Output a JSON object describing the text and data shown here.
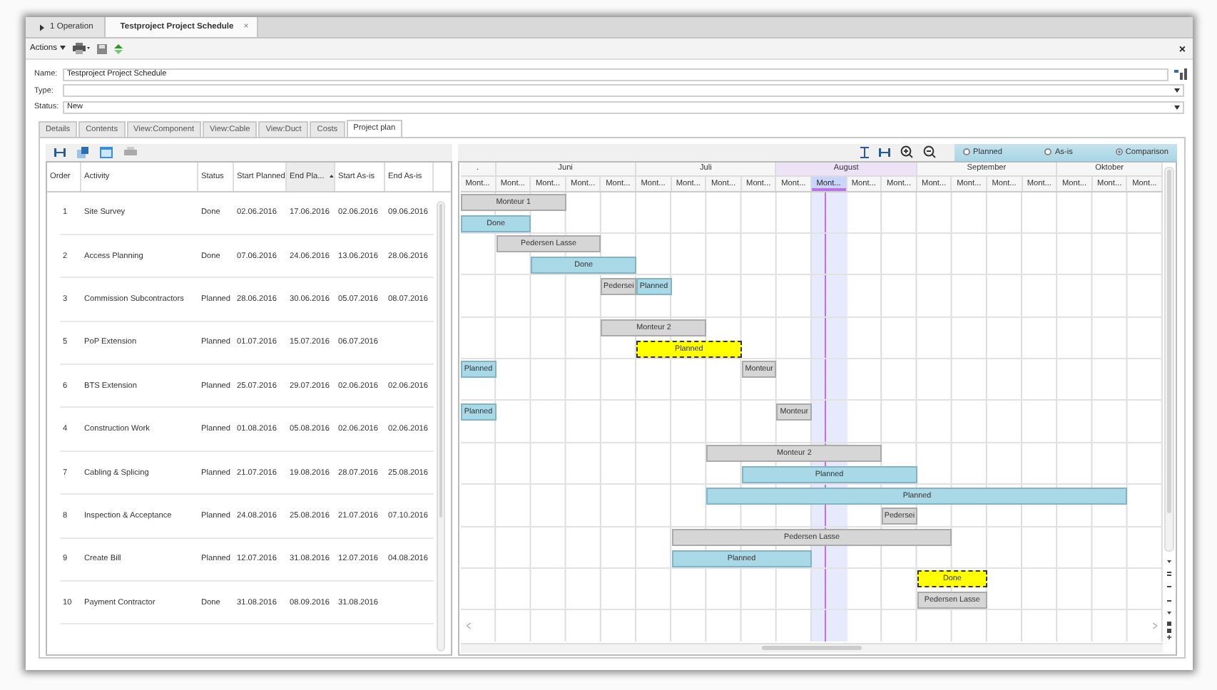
{
  "tabs": [
    {
      "label": "1 Operation",
      "selected": false,
      "kind": "group"
    },
    {
      "label": "Testproject Project Schedule",
      "selected": true,
      "kind": "document",
      "close": "×"
    }
  ],
  "toolbar": {
    "actions": "Actions",
    "close": "×"
  },
  "form": {
    "fields": [
      {
        "label": "Name:",
        "value": "Testproject Project Schedule",
        "kind": "text"
      },
      {
        "label": "Type:",
        "kind": "dropdown"
      },
      {
        "label": "Status:",
        "value": "New",
        "kind": "dropdown"
      }
    ]
  },
  "detail_tabs": [
    {
      "label": "Details",
      "selected": false
    },
    {
      "label": "Contents",
      "selected": false
    },
    {
      "label": "View:Component",
      "selected": false
    },
    {
      "label": "View:Cable",
      "selected": false
    },
    {
      "label": "View:Duct",
      "selected": false
    },
    {
      "label": "Costs",
      "selected": false
    },
    {
      "label": "Project plan",
      "selected": true
    }
  ],
  "table": {
    "columns": [
      {
        "label": "Order",
        "sorted": false
      },
      {
        "label": "Activity",
        "sorted": false
      },
      {
        "label": "Status",
        "sorted": false
      },
      {
        "label": "Start Planned",
        "sorted": false
      },
      {
        "label": "End Pla...",
        "sorted": true
      },
      {
        "label": "Start As-is",
        "sorted": false
      },
      {
        "label": "End As-is",
        "sorted": false
      }
    ],
    "rows": [
      [
        "1",
        "Site Survey",
        "Done",
        "02.06.2016",
        "17.06.2016",
        "02.06.2016",
        "09.06.2016"
      ],
      [
        "2",
        "Access Planning",
        "Done",
        "07.06.2016",
        "24.06.2016",
        "13.06.2016",
        "28.06.2016"
      ],
      [
        "3",
        "Commission Subcontractors",
        "Planned",
        "28.06.2016",
        "30.06.2016",
        "05.07.2016",
        "08.07.2016"
      ],
      [
        "5",
        "PoP Extension",
        "Planned",
        "01.07.2016",
        "15.07.2016",
        "06.07.2016",
        null
      ],
      [
        "6",
        "BTS Extension",
        "Planned",
        "25.07.2016",
        "29.07.2016",
        "02.06.2016",
        "02.06.2016"
      ],
      [
        "4",
        "Construction Work",
        "Planned",
        "01.08.2016",
        "05.08.2016",
        "02.06.2016",
        "02.06.2016"
      ],
      [
        "7",
        "Cabling & Splicing",
        "Planned",
        "21.07.2016",
        "19.08.2016",
        "28.07.2016",
        "25.08.2016"
      ],
      [
        "8",
        "Inspection & Acceptance",
        "Planned",
        "24.08.2016",
        "25.08.2016",
        "21.07.2016",
        "07.10.2016"
      ],
      [
        "9",
        "Create Bill",
        "Planned",
        "12.07.2016",
        "31.08.2016",
        "12.07.2016",
        "04.08.2016"
      ],
      [
        "10",
        "Payment Contractor",
        "Done",
        "31.08.2016",
        "08.09.2016",
        "31.08.2016",
        null
      ]
    ]
  },
  "gantt": {
    "view_options": [
      {
        "label": "Planned",
        "selected": false
      },
      {
        "label": "As-is",
        "selected": false
      },
      {
        "label": "Comparison",
        "selected": true
      }
    ],
    "months": [
      {
        "label": ".",
        "highlighted": false
      },
      {
        "label": "Juni",
        "highlighted": false
      },
      {
        "label": "Juli",
        "highlighted": false
      },
      {
        "label": "August",
        "highlighted": true
      },
      {
        "label": "September",
        "highlighted": false
      },
      {
        "label": "Oktober",
        "highlighted": false
      }
    ],
    "weeks": [
      {
        "label": "Mont...",
        "highlighted": false
      },
      {
        "label": "Mont...",
        "highlighted": false
      },
      {
        "label": "Mont...",
        "highlighted": false
      },
      {
        "label": "Mont...",
        "highlighted": false
      },
      {
        "label": "Mont...",
        "highlighted": false
      },
      {
        "label": "Mont...",
        "highlighted": false
      },
      {
        "label": "Mont...",
        "highlighted": false
      },
      {
        "label": "Mont...",
        "highlighted": false
      },
      {
        "label": "Mont...",
        "highlighted": false
      },
      {
        "label": "Mont...",
        "highlighted": false
      },
      {
        "label": "Mont...",
        "highlighted": true
      },
      {
        "label": "Mont...",
        "highlighted": false
      },
      {
        "label": "Mont...",
        "highlighted": false
      },
      {
        "label": "Mont...",
        "highlighted": false
      },
      {
        "label": "Mont...",
        "highlighted": false
      },
      {
        "label": "Mont...",
        "highlighted": false
      },
      {
        "label": "Mont...",
        "highlighted": false
      },
      {
        "label": "Mont...",
        "highlighted": false
      },
      {
        "label": "Mont...",
        "highlighted": false
      },
      {
        "label": "Mont...",
        "highlighted": false
      }
    ],
    "rows": [
      {
        "lanes": [
          [
            {
              "label": "Monteur 1",
              "kind": "resource"
            }
          ],
          [
            {
              "label": "Done",
              "kind": "task"
            }
          ]
        ]
      },
      {
        "lanes": [
          [
            {
              "label": "Pedersen Lasse",
              "kind": "resource"
            }
          ],
          [
            {
              "label": "Done",
              "kind": "task"
            }
          ]
        ]
      },
      {
        "lanes": [
          [
            {
              "label": "Pedersei",
              "kind": "resource"
            },
            {
              "label": "Planned",
              "kind": "task"
            }
          ]
        ]
      },
      {
        "lanes": [
          [
            {
              "label": "Monteur 2",
              "kind": "resource"
            }
          ],
          [
            {
              "label": "Planned",
              "kind": "flagged"
            }
          ]
        ]
      },
      {
        "lanes": [
          [
            {
              "label": "Planned",
              "kind": "task"
            },
            {
              "label": "Monteur",
              "kind": "resource"
            }
          ]
        ]
      },
      {
        "lanes": [
          [
            {
              "label": "Planned",
              "kind": "task"
            },
            {
              "label": "Monteur",
              "kind": "resource"
            }
          ]
        ]
      },
      {
        "lanes": [
          [
            {
              "label": "Monteur 2",
              "kind": "resource"
            }
          ],
          [
            {
              "label": "Planned",
              "kind": "task"
            }
          ]
        ]
      },
      {
        "lanes": [
          [
            {
              "label": "Planned",
              "kind": "task"
            }
          ],
          [
            {
              "label": "Pedersei",
              "kind": "resource"
            }
          ]
        ]
      },
      {
        "lanes": [
          [
            {
              "label": "Pedersen Lasse",
              "kind": "resource"
            }
          ],
          [
            {
              "label": "Planned",
              "kind": "task"
            }
          ]
        ]
      },
      {
        "lanes": [
          [
            {
              "label": "Done",
              "kind": "flagged"
            }
          ],
          [
            {
              "label": "Pedersen Lasse",
              "kind": "resource"
            }
          ]
        ]
      }
    ]
  }
}
